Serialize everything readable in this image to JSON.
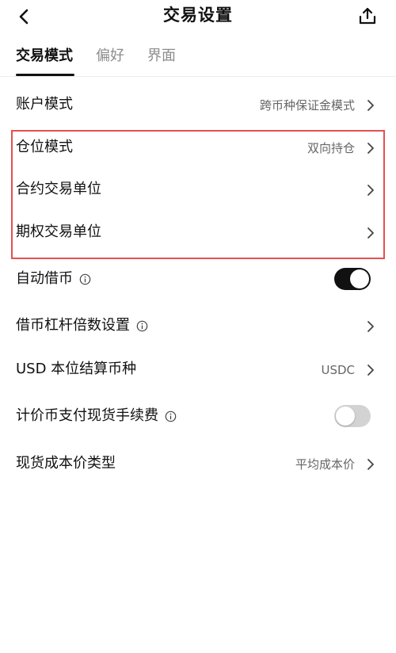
{
  "header": {
    "title": "交易设置",
    "back_icon": "chevron-left-icon",
    "share_icon": "share-upload-icon"
  },
  "tabs": [
    {
      "label": "交易模式",
      "active": true
    },
    {
      "label": "偏好",
      "active": false
    },
    {
      "label": "界面",
      "active": false
    }
  ],
  "rows": {
    "account_mode": {
      "label": "账户模式",
      "value": "跨币种保证金模式"
    },
    "position_mode": {
      "label": "仓位模式",
      "value": "双向持仓"
    },
    "contract_unit": {
      "label": "合约交易单位"
    },
    "option_unit": {
      "label": "期权交易单位"
    },
    "auto_borrow": {
      "label": "自动借币",
      "toggle_on": true
    },
    "borrow_leverage": {
      "label": "借币杠杆倍数设置"
    },
    "usd_settle": {
      "label": "USD 本位结算币种",
      "value": "USDC"
    },
    "quote_fee": {
      "label": "计价币支付现货手续费",
      "toggle_on": false
    },
    "spot_cost": {
      "label": "现货成本价类型",
      "value": "平均成本价"
    }
  },
  "colors": {
    "highlight_border": "#e35050",
    "toggle_on": "#111111",
    "toggle_off": "#d3d3d3",
    "secondary_text": "#666666"
  }
}
